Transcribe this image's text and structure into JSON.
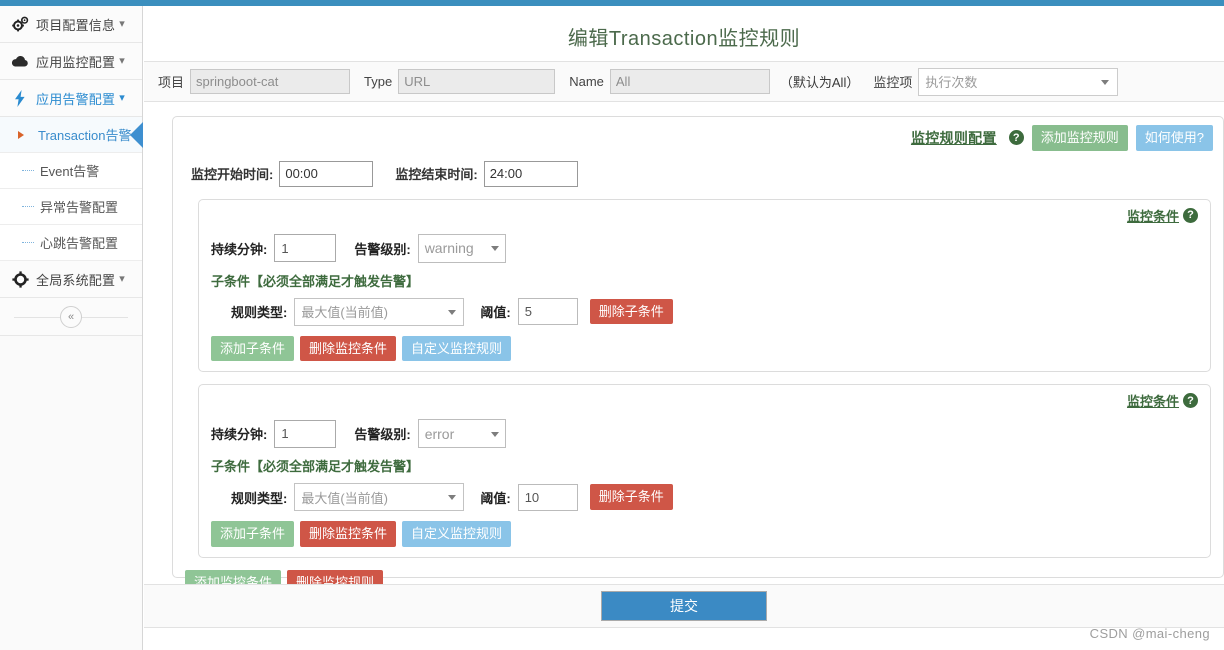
{
  "theme": {
    "accent": "#3b8fbe",
    "green_btn": "#88bd8e",
    "blue_btn": "#8ac4e8",
    "red_btn": "#cf5647",
    "submit_blue": "#3b8ac4",
    "title_green": "#4c6a4c",
    "link_blue": "#3a8ccc"
  },
  "sidebar": {
    "groups": [
      {
        "label": "项目配置信息",
        "icon": "gears-icon",
        "caret": "⌄",
        "active": false
      },
      {
        "label": "应用监控配置",
        "icon": "cloud-icon",
        "caret": "⌄",
        "active": false
      },
      {
        "label": "应用告警配置",
        "icon": "bolt-icon",
        "caret": "⌄",
        "active": true
      }
    ],
    "sub_items": [
      {
        "label": "Transaction告警",
        "current": true
      },
      {
        "label": "Event告警",
        "current": false
      },
      {
        "label": "异常告警配置",
        "current": false
      },
      {
        "label": "心跳告警配置",
        "current": false
      }
    ],
    "bottom_group": {
      "label": "全局系统配置",
      "icon": "gear-icon",
      "caret": "⌄"
    },
    "collapse_label": "«"
  },
  "header": {
    "page_title": "编辑Transaction监控规则"
  },
  "filter": {
    "project_label": "项目",
    "project_value": "springboot-cat",
    "type_label": "Type",
    "type_value": "URL",
    "name_label": "Name",
    "name_value": "All",
    "note": "（默认为All）",
    "monitor_item_label": "监控项",
    "monitor_item_value": "执行次数",
    "dropdown_arrow": "▼"
  },
  "rule_panel": {
    "head_title": "监控规则配置",
    "help_icon": "?",
    "add_rule_button": "添加监控规则",
    "how_to_use_button": "如何使用?",
    "start_time_label": "监控开始时间:",
    "start_time_value": "00:00",
    "end_time_label": "监控结束时间:",
    "end_time_value": "24:00",
    "add_condition_button": "添加监控条件",
    "delete_rule_button": "删除监控规则"
  },
  "condition_labels": {
    "title": "监控条件",
    "help_icon": "?",
    "duration_label": "持续分钟:",
    "level_label": "告警级别:",
    "sub_note": "子条件【必须全部满足才触发告警】",
    "rule_type_label": "规则类型:",
    "threshold_label": "阈值:",
    "delete_sub_button": "删除子条件",
    "add_sub_button": "添加子条件",
    "delete_condition_button": "删除监控条件",
    "custom_rule_button": "自定义监控规则",
    "dropdown_arrow": "▼"
  },
  "conditions": [
    {
      "duration": "1",
      "level": "warning",
      "sub_conditions": [
        {
          "rule_type": "最大值(当前值)",
          "threshold": "5"
        }
      ]
    },
    {
      "duration": "1",
      "level": "error",
      "sub_conditions": [
        {
          "rule_type": "最大值(当前值)",
          "threshold": "10"
        }
      ]
    }
  ],
  "footer": {
    "submit_button": "提交",
    "watermark": "CSDN @mai-cheng"
  }
}
